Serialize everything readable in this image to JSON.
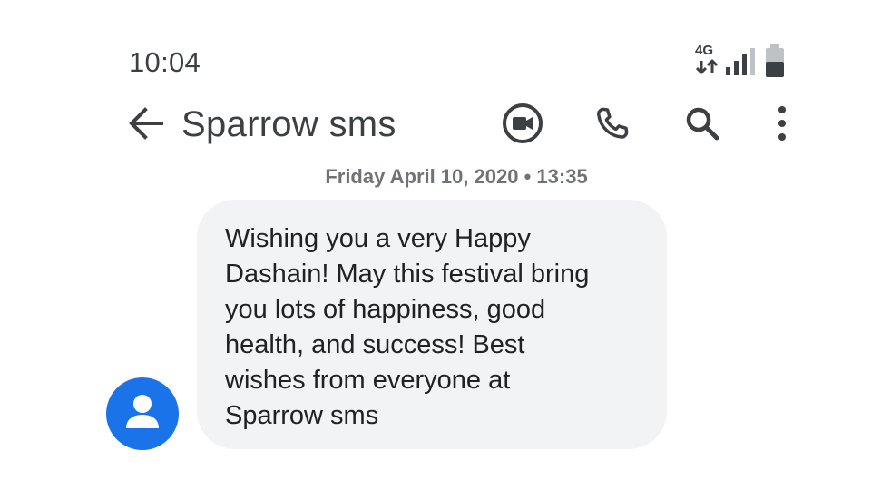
{
  "status_bar": {
    "time": "10:04",
    "network_type": "4G",
    "icons": [
      "data-transfer-icon",
      "signal-icon",
      "battery-icon"
    ]
  },
  "app_bar": {
    "title": "Sparrow sms",
    "actions": [
      "video-call-icon",
      "phone-icon",
      "search-icon",
      "more-vert-icon"
    ]
  },
  "conversation": {
    "date_divider": "Friday April 10, 2020 • 13:35",
    "messages": [
      {
        "text": "Wishing you a very Happy\nDashain! May this festival bring\nyou lots of happiness, good\nhealth, and success! Best\nwishes from everyone at\nSparrow sms"
      }
    ]
  },
  "colors": {
    "text_primary": "#3c4043",
    "bubble_background": "#f1f3f4",
    "avatar_background": "#1a73e8",
    "date_text": "#6f7378"
  }
}
